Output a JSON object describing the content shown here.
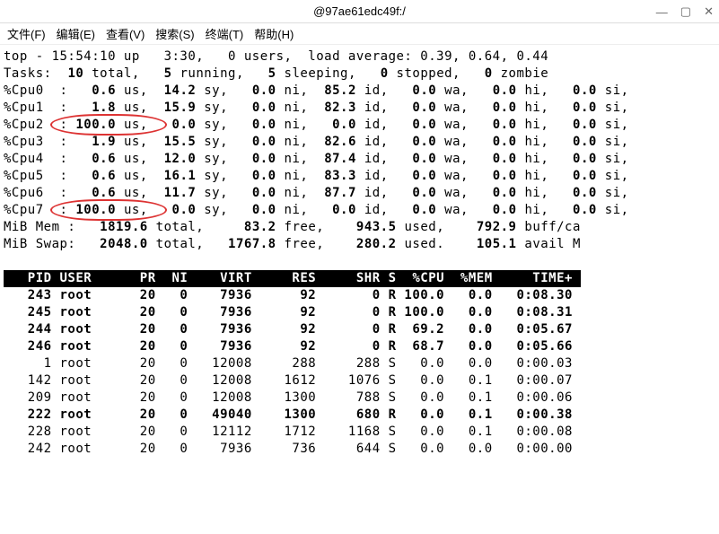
{
  "window": {
    "title": "@97ae61edc49f:/"
  },
  "menu": {
    "file": "文件(F)",
    "edit": "编辑(E)",
    "view": "查看(V)",
    "search": "搜索(S)",
    "terminal": "终端(T)",
    "help": "帮助(H)"
  },
  "top": {
    "time": "15:54:10",
    "up": "3:30",
    "users": "0",
    "load": [
      "0.39",
      "0.64",
      "0.44"
    ]
  },
  "tasks": {
    "total": "10",
    "running": "5",
    "sleeping": "5",
    "stopped": "0",
    "zombie": "0"
  },
  "cpus": [
    {
      "n": "0",
      "us": "0.6",
      "sy": "14.2",
      "ni": "0.0",
      "id": "85.2",
      "wa": "0.0",
      "hi": "0.0",
      "si": "0.0"
    },
    {
      "n": "1",
      "us": "1.8",
      "sy": "15.9",
      "ni": "0.0",
      "id": "82.3",
      "wa": "0.0",
      "hi": "0.0",
      "si": "0.0"
    },
    {
      "n": "2",
      "us": "100.0",
      "sy": "0.0",
      "ni": "0.0",
      "id": "0.0",
      "wa": "0.0",
      "hi": "0.0",
      "si": "0.0"
    },
    {
      "n": "3",
      "us": "1.9",
      "sy": "15.5",
      "ni": "0.0",
      "id": "82.6",
      "wa": "0.0",
      "hi": "0.0",
      "si": "0.0"
    },
    {
      "n": "4",
      "us": "0.6",
      "sy": "12.0",
      "ni": "0.0",
      "id": "87.4",
      "wa": "0.0",
      "hi": "0.0",
      "si": "0.0"
    },
    {
      "n": "5",
      "us": "0.6",
      "sy": "16.1",
      "ni": "0.0",
      "id": "83.3",
      "wa": "0.0",
      "hi": "0.0",
      "si": "0.0"
    },
    {
      "n": "6",
      "us": "0.6",
      "sy": "11.7",
      "ni": "0.0",
      "id": "87.7",
      "wa": "0.0",
      "hi": "0.0",
      "si": "0.0"
    },
    {
      "n": "7",
      "us": "100.0",
      "sy": "0.0",
      "ni": "0.0",
      "id": "0.0",
      "wa": "0.0",
      "hi": "0.0",
      "si": "0.0"
    }
  ],
  "mem": {
    "total": "1819.6",
    "free": "83.2",
    "used": "943.5",
    "buff": "792.9"
  },
  "swap": {
    "total": "2048.0",
    "free": "1767.8",
    "used": "280.2",
    "avail": "105.1"
  },
  "header": {
    "pid": "PID",
    "user": "USER",
    "pr": "PR",
    "ni": "NI",
    "virt": "VIRT",
    "res": "RES",
    "shr": "SHR",
    "s": "S",
    "cpu": "%CPU",
    "mem": "%MEM",
    "time": "TIME+"
  },
  "procs": [
    {
      "bold": true,
      "pid": "243",
      "user": "root",
      "pr": "20",
      "ni": "0",
      "virt": "7936",
      "res": "92",
      "shr": "0",
      "s": "R",
      "cpu": "100.0",
      "mem": "0.0",
      "time": "0:08.30"
    },
    {
      "bold": true,
      "pid": "245",
      "user": "root",
      "pr": "20",
      "ni": "0",
      "virt": "7936",
      "res": "92",
      "shr": "0",
      "s": "R",
      "cpu": "100.0",
      "mem": "0.0",
      "time": "0:08.31"
    },
    {
      "bold": true,
      "pid": "244",
      "user": "root",
      "pr": "20",
      "ni": "0",
      "virt": "7936",
      "res": "92",
      "shr": "0",
      "s": "R",
      "cpu": "69.2",
      "mem": "0.0",
      "time": "0:05.67"
    },
    {
      "bold": true,
      "pid": "246",
      "user": "root",
      "pr": "20",
      "ni": "0",
      "virt": "7936",
      "res": "92",
      "shr": "0",
      "s": "R",
      "cpu": "68.7",
      "mem": "0.0",
      "time": "0:05.66"
    },
    {
      "bold": false,
      "pid": "1",
      "user": "root",
      "pr": "20",
      "ni": "0",
      "virt": "12008",
      "res": "288",
      "shr": "288",
      "s": "S",
      "cpu": "0.0",
      "mem": "0.0",
      "time": "0:00.03"
    },
    {
      "bold": false,
      "pid": "142",
      "user": "root",
      "pr": "20",
      "ni": "0",
      "virt": "12008",
      "res": "1612",
      "shr": "1076",
      "s": "S",
      "cpu": "0.0",
      "mem": "0.1",
      "time": "0:00.07"
    },
    {
      "bold": false,
      "pid": "209",
      "user": "root",
      "pr": "20",
      "ni": "0",
      "virt": "12008",
      "res": "1300",
      "shr": "788",
      "s": "S",
      "cpu": "0.0",
      "mem": "0.1",
      "time": "0:00.06"
    },
    {
      "bold": true,
      "pid": "222",
      "user": "root",
      "pr": "20",
      "ni": "0",
      "virt": "49040",
      "res": "1300",
      "shr": "680",
      "s": "R",
      "cpu": "0.0",
      "mem": "0.1",
      "time": "0:00.38"
    },
    {
      "bold": false,
      "pid": "228",
      "user": "root",
      "pr": "20",
      "ni": "0",
      "virt": "12112",
      "res": "1712",
      "shr": "1168",
      "s": "S",
      "cpu": "0.0",
      "mem": "0.1",
      "time": "0:00.08"
    },
    {
      "bold": false,
      "pid": "242",
      "user": "root",
      "pr": "20",
      "ni": "0",
      "virt": "7936",
      "res": "736",
      "shr": "644",
      "s": "S",
      "cpu": "0.0",
      "mem": "0.0",
      "time": "0:00.00"
    }
  ],
  "labels": {
    "top": "top - ",
    "up": " up ",
    "users": "users,",
    "loadavg": "load average:",
    "tasks": "Tasks:",
    "total": "total,",
    "running": "running,",
    "sleeping": "sleeping,",
    "stopped": "stopped,",
    "zombie": "zombie",
    "cpu": "%Cpu",
    "us": "us,",
    "sy": "sy,",
    "ni": "ni,",
    "id": "id,",
    "wa": "wa,",
    "hi": "hi,",
    "si": "si,",
    "mem": "MiB Mem :",
    "swap": "MiB Swap:",
    "free": "free,",
    "used": "used,",
    "used2": "used.",
    "buff": "buff/ca",
    "avail": "avail M"
  }
}
